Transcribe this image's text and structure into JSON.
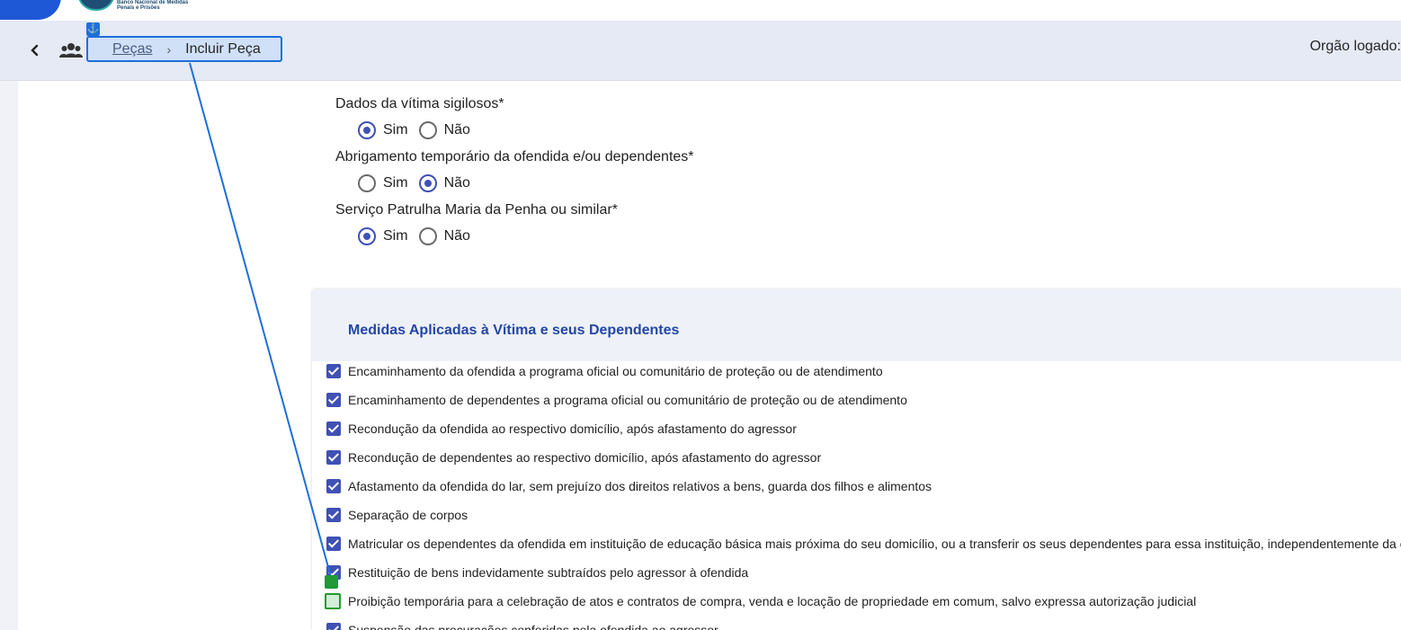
{
  "header": {
    "logo_text": "Banco Nacional de Medidas Penais e Prisões"
  },
  "nav": {
    "breadcrumb": [
      {
        "label": "Peças"
      },
      {
        "label": "Incluir Peça"
      }
    ],
    "org_label": "Orgão logado:"
  },
  "form": {
    "fields": [
      {
        "label": "Dados da vítima sigilosos*",
        "options": [
          "Sim",
          "Não"
        ],
        "selected": "Sim"
      },
      {
        "label": "Abrigamento temporário da ofendida e/ou dependentes*",
        "options": [
          "Sim",
          "Não"
        ],
        "selected": "Não"
      },
      {
        "label": "Serviço Patrulha Maria da Penha ou similar*",
        "options": [
          "Sim",
          "Não"
        ],
        "selected": "Sim"
      }
    ]
  },
  "measures": {
    "title": "Medidas Aplicadas à Vítima e seus Dependentes",
    "items": [
      {
        "label": "Encaminhamento da ofendida a programa oficial ou comunitário de proteção ou de atendimento",
        "checked": true
      },
      {
        "label": "Encaminhamento de dependentes a programa oficial ou comunitário de proteção ou de atendimento",
        "checked": true
      },
      {
        "label": "Recondução da ofendida ao respectivo domicílio, após afastamento do agressor",
        "checked": true
      },
      {
        "label": "Recondução de dependentes ao respectivo domicílio, após afastamento do agressor",
        "checked": true
      },
      {
        "label": "Afastamento da ofendida do lar, sem prejuízo dos direitos relativos a bens, guarda dos filhos e alimentos",
        "checked": true
      },
      {
        "label": "Separação de corpos",
        "checked": true
      },
      {
        "label": "Matricular os dependentes da ofendida em instituição de educação básica mais próxima do seu domicílio, ou a transferir os seus dependentes para essa instituição, independentemente da e",
        "checked": true
      },
      {
        "label": "Restituição de bens indevidamente subtraídos pelo agressor à ofendida",
        "checked": true
      },
      {
        "label": "Proibição temporária para a celebração de atos e contratos de compra, venda e locação de propriedade em comum, salvo expressa autorização judicial",
        "checked": true
      },
      {
        "label": "Suspensão das procurações conferidas pela ofendida ao agressor",
        "checked": true
      }
    ]
  },
  "icons": {
    "back": "chevron-left-icon",
    "users": "users-icon",
    "anchor": "anchor-icon"
  },
  "colors": {
    "accent": "#3f51b5",
    "brand": "#1e58d6",
    "title": "#2347a5",
    "nav_bg": "#e5eaf4"
  }
}
